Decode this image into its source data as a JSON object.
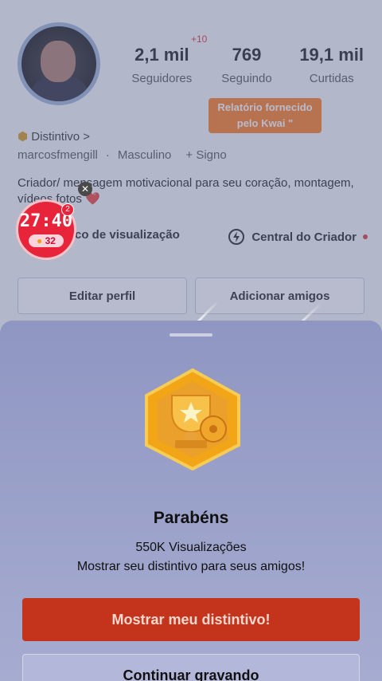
{
  "profile": {
    "stats": [
      {
        "value": "2,1 mil",
        "label": "Seguidores"
      },
      {
        "value": "769",
        "label": "Seguindo"
      },
      {
        "value": "19,1 mil",
        "label": "Curtidas"
      }
    ],
    "followers_increase": "+10",
    "kwai_note_line1": "Relatório fornecido",
    "kwai_note_line2": "pelo Kwai \"",
    "badge_label": "Distintivo >",
    "username": "marcosfmengill",
    "gender": "Masculino",
    "sign": "+ Signo",
    "bio": "Criador/ mensagem motivacional para seu coração, montagem, vídeos fotos ❤️",
    "history_label": "rico de visualização",
    "creator_center_label": "Central do Criador",
    "edit_profile_label": "Editar perfil",
    "add_friends_label": "Adicionar amigos"
  },
  "timer": {
    "time": "27:40",
    "coins": "32",
    "badge_count": "2",
    "close_icon": "✕"
  },
  "sheet": {
    "title": "Parabéns",
    "views": "550K Visualizações",
    "message": "Mostrar seu distintivo para seus amigos!",
    "primary_button": "Mostrar meu distintivo!",
    "secondary_button": "Continuar gravando"
  },
  "colors": {
    "accent_red": "#c4341c",
    "kwai_orange": "#ff7a1a",
    "timer_red": "#e8243a"
  }
}
